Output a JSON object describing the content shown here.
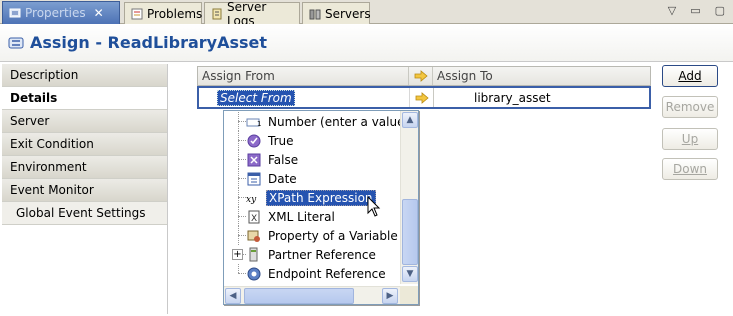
{
  "tabs": [
    {
      "label": "Properties",
      "icon": "properties-icon",
      "active": true
    },
    {
      "label": "Problems",
      "icon": "problems-icon"
    },
    {
      "label": "Server Logs",
      "icon": "server-logs-icon"
    },
    {
      "label": "Servers",
      "icon": "servers-icon"
    }
  ],
  "header": {
    "title": "Assign - ReadLibraryAsset",
    "icon": "assign-icon"
  },
  "sidebar": {
    "items": [
      {
        "label": "Description"
      },
      {
        "label": "Details",
        "active": true
      },
      {
        "label": "Server"
      },
      {
        "label": "Exit Condition"
      },
      {
        "label": "Environment"
      },
      {
        "label": "Event Monitor"
      },
      {
        "label": "Global Event Settings",
        "sub": true
      }
    ]
  },
  "grid": {
    "columns": [
      "Assign From",
      "Assign To"
    ],
    "row": {
      "from": "Select From",
      "to": "library_asset"
    }
  },
  "buttons": {
    "add": "Add",
    "remove": "Remove",
    "up": "Up",
    "down": "Down"
  },
  "dropdown": {
    "items": [
      {
        "label": "Number (enter a value",
        "icon": "number-icon"
      },
      {
        "label": "True",
        "icon": "true-icon"
      },
      {
        "label": "False",
        "icon": "false-icon"
      },
      {
        "label": "Date",
        "icon": "date-icon"
      },
      {
        "label": "XPath Expression",
        "icon": "xpath-icon",
        "selected": true
      },
      {
        "label": "XML Literal",
        "icon": "xml-literal-icon"
      },
      {
        "label": "Property of a Variable",
        "icon": "variable-property-icon"
      },
      {
        "label": "Partner Reference",
        "icon": "partner-reference-icon",
        "expandable": true
      },
      {
        "label": "Endpoint Reference",
        "icon": "endpoint-reference-icon"
      }
    ]
  },
  "colors": {
    "accent": "#2553b0",
    "title": "#1f4f9a"
  }
}
